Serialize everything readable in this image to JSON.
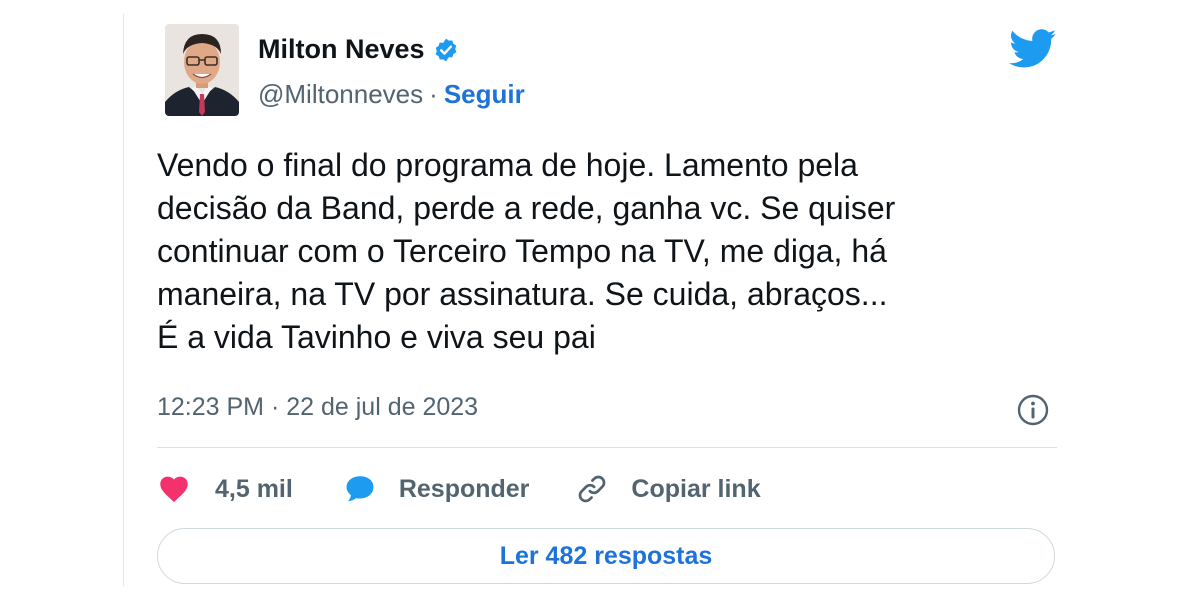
{
  "author": {
    "name": "Milton Neves",
    "handle": "@Miltonneves",
    "separator": "·",
    "follow_label": "Seguir",
    "verified": true
  },
  "tweet": {
    "text": "Vendo o final do programa de hoje. Lamento pela\ndecisão da Band, perde a rede, ganha vc. Se quiser\ncontinuar com o Terceiro Tempo na TV, me diga, há\nmaneira, na TV por assinatura. Se cuida, abraços...\nÉ a vida Tavinho e viva seu pai",
    "timestamp": "12:23 PM · 22 de jul de 2023"
  },
  "actions": {
    "likes_label": "4,5 mil",
    "reply_label": "Responder",
    "copy_link_label": "Copiar link"
  },
  "read_replies_label": "Ler 482 respostas",
  "icons": {
    "brand": "twitter-bird-icon",
    "verified": "verified-badge-icon",
    "info": "info-icon",
    "like": "heart-icon",
    "reply": "speech-bubble-icon",
    "copy": "link-icon"
  },
  "colors": {
    "twitter_blue": "#1d9bf0",
    "link_blue": "#1d73d8",
    "like_pink": "#f4306d",
    "reply_blue": "#1d9bf0",
    "secondary_text": "#536471"
  }
}
